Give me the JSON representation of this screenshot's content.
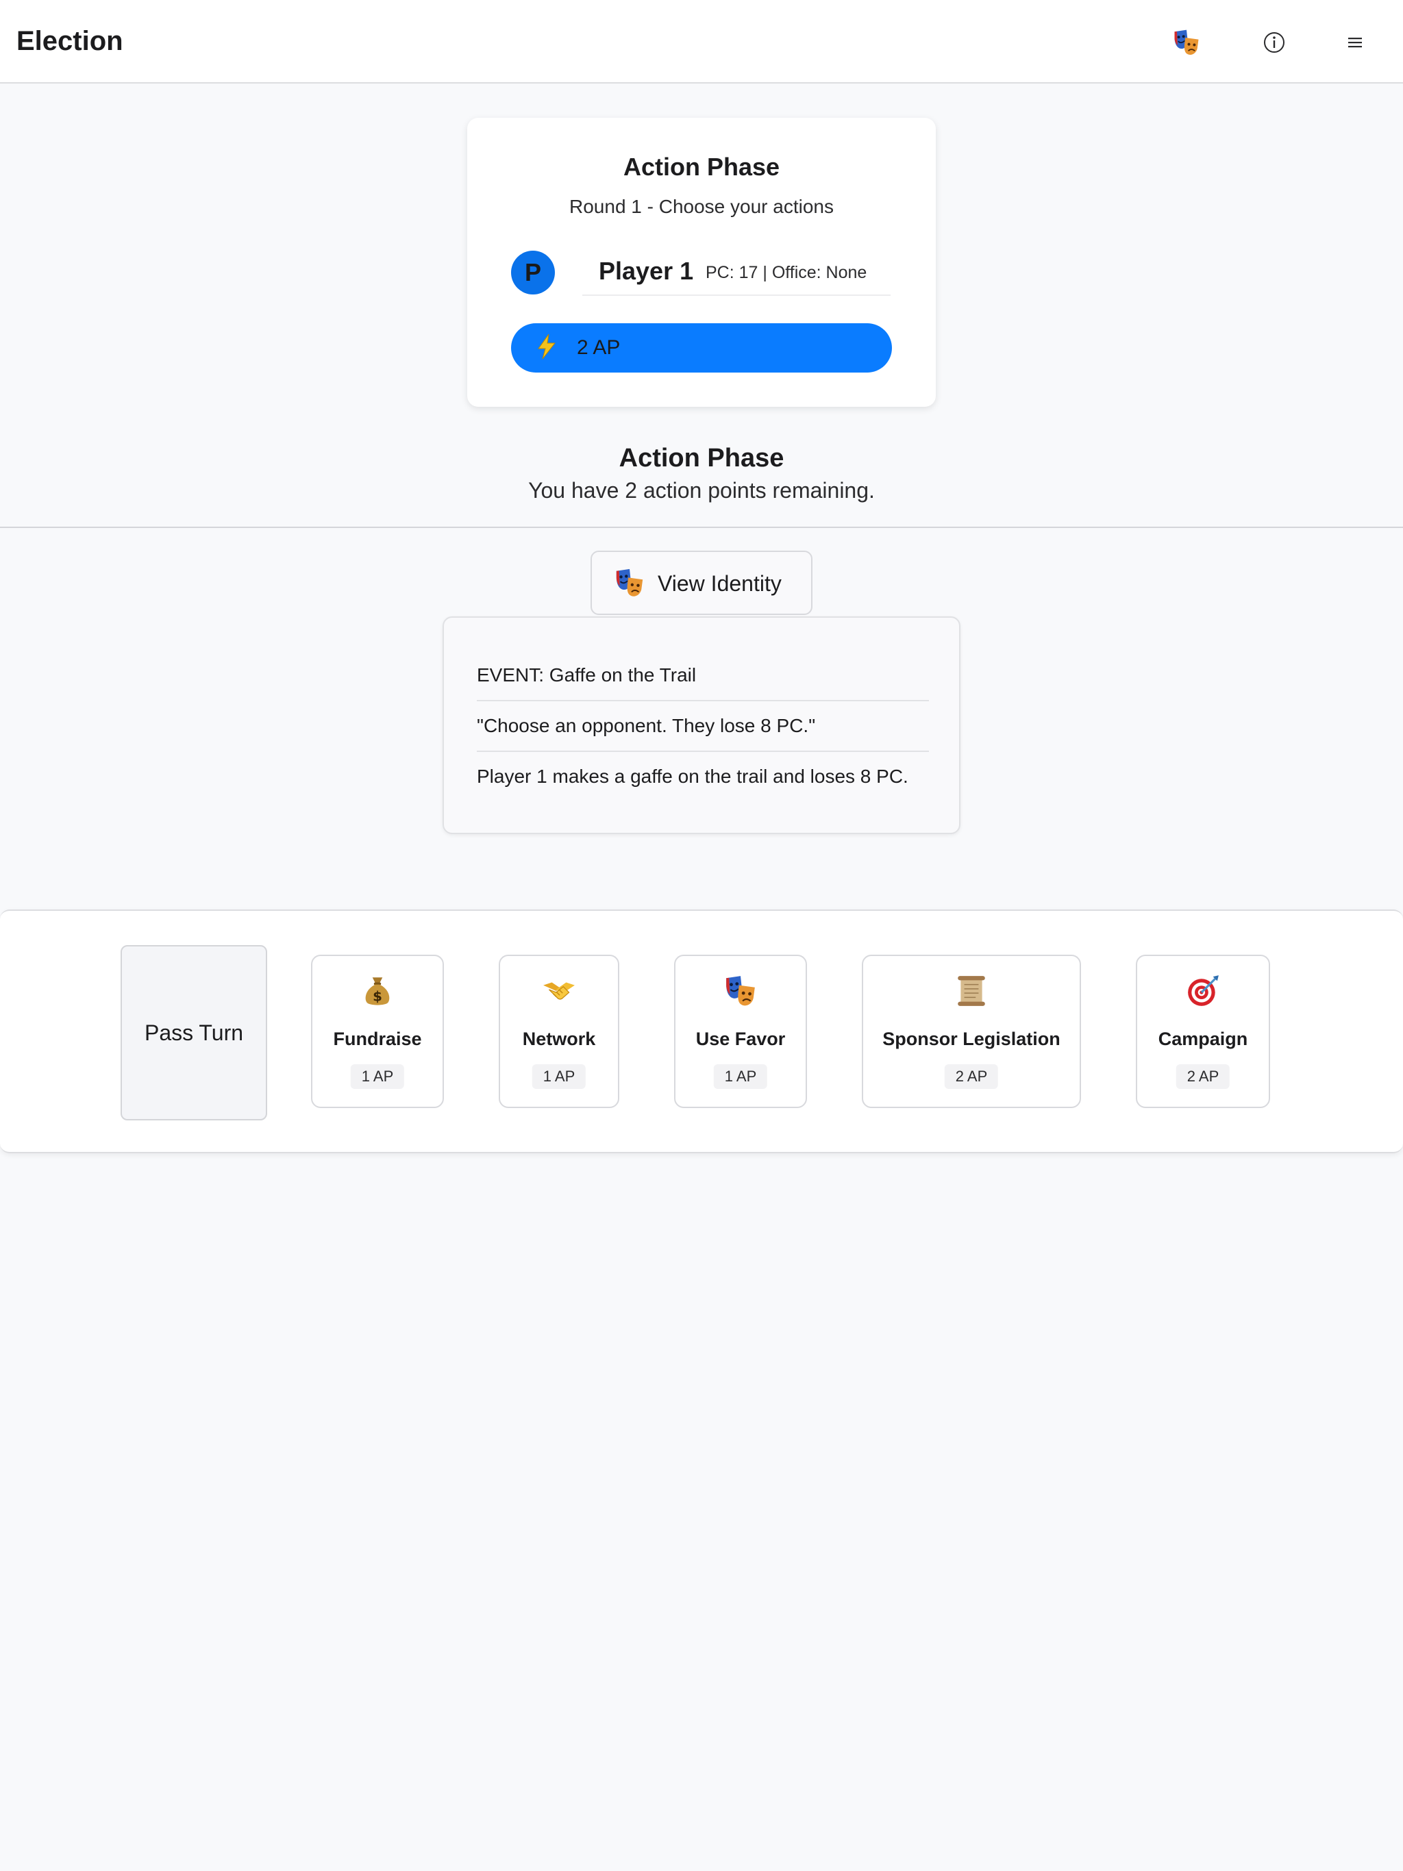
{
  "header": {
    "title": "Election",
    "identity_icon": "theater-masks-icon",
    "info_icon": "info-icon",
    "menu_icon": "hamburger-menu-icon"
  },
  "phase_card": {
    "title": "Action Phase",
    "subtitle": "Round 1 - Choose your actions",
    "avatar_letter": "P",
    "player_name": "Player 1",
    "player_stats": "PC: 17 | Office: None",
    "ap_icon": "lightning-icon",
    "ap_label": "2 AP"
  },
  "status": {
    "title": "Action Phase",
    "subtitle": "You have 2 action points remaining."
  },
  "view_identity": {
    "icon": "theater-masks-icon",
    "label": "View Identity"
  },
  "event": {
    "lines": [
      "EVENT: Gaffe on the Trail",
      "\"Choose an opponent. They lose 8 PC.\"",
      "Player 1 makes a gaffe on the trail and loses 8 PC."
    ]
  },
  "actions": {
    "pass_label": "Pass Turn",
    "items": [
      {
        "icon": "money-bag-icon",
        "name": "Fundraise",
        "cost": "1 AP"
      },
      {
        "icon": "handshake-icon",
        "name": "Network",
        "cost": "1 AP"
      },
      {
        "icon": "theater-masks-icon",
        "name": "Use Favor",
        "cost": "1 AP"
      },
      {
        "icon": "scroll-icon",
        "name": "Sponsor Legislation",
        "cost": "2 AP"
      },
      {
        "icon": "target-icon",
        "name": "Campaign",
        "cost": "2 AP"
      }
    ]
  },
  "colors": {
    "accent_blue": "#0a7cff",
    "avatar_blue": "#0a72ea",
    "page_background": "#f8f9fb"
  }
}
